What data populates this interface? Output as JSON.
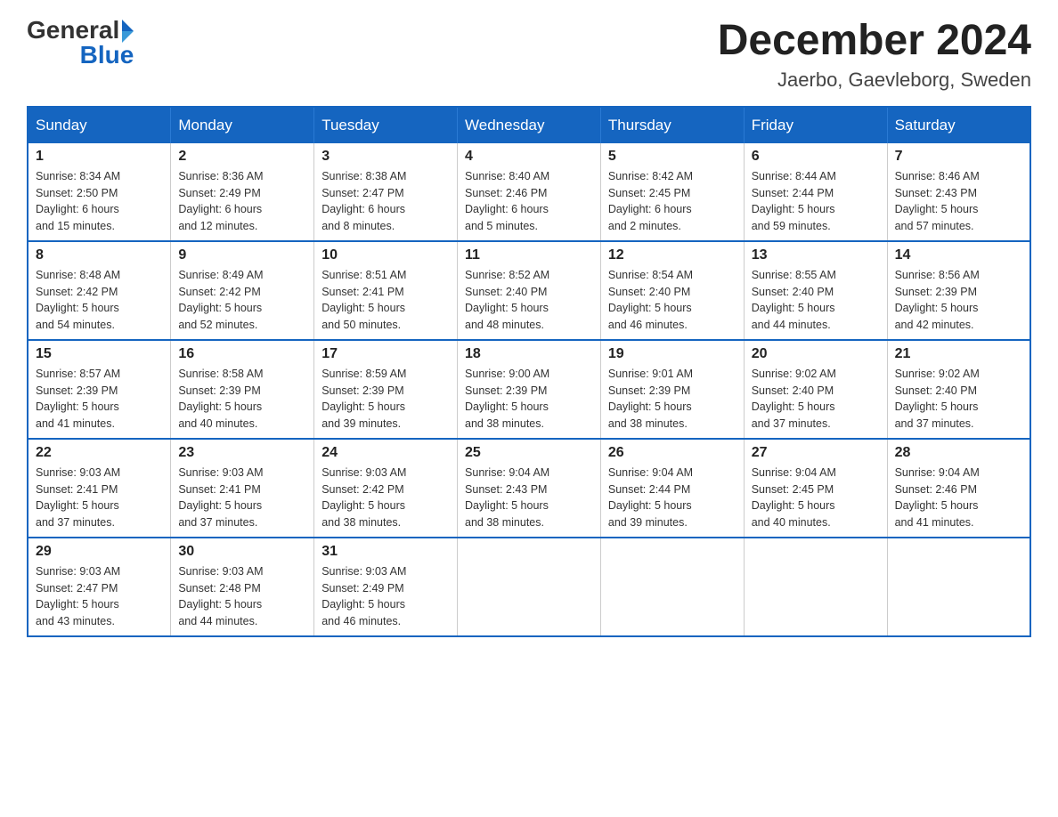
{
  "header": {
    "logo": {
      "text_general": "General",
      "text_blue": "Blue"
    },
    "month_title": "December 2024",
    "location": "Jaerbo, Gaevleborg, Sweden"
  },
  "weekdays": [
    "Sunday",
    "Monday",
    "Tuesday",
    "Wednesday",
    "Thursday",
    "Friday",
    "Saturday"
  ],
  "weeks": [
    [
      {
        "day": "1",
        "sunrise": "Sunrise: 8:34 AM",
        "sunset": "Sunset: 2:50 PM",
        "daylight": "Daylight: 6 hours",
        "daylight2": "and 15 minutes."
      },
      {
        "day": "2",
        "sunrise": "Sunrise: 8:36 AM",
        "sunset": "Sunset: 2:49 PM",
        "daylight": "Daylight: 6 hours",
        "daylight2": "and 12 minutes."
      },
      {
        "day": "3",
        "sunrise": "Sunrise: 8:38 AM",
        "sunset": "Sunset: 2:47 PM",
        "daylight": "Daylight: 6 hours",
        "daylight2": "and 8 minutes."
      },
      {
        "day": "4",
        "sunrise": "Sunrise: 8:40 AM",
        "sunset": "Sunset: 2:46 PM",
        "daylight": "Daylight: 6 hours",
        "daylight2": "and 5 minutes."
      },
      {
        "day": "5",
        "sunrise": "Sunrise: 8:42 AM",
        "sunset": "Sunset: 2:45 PM",
        "daylight": "Daylight: 6 hours",
        "daylight2": "and 2 minutes."
      },
      {
        "day": "6",
        "sunrise": "Sunrise: 8:44 AM",
        "sunset": "Sunset: 2:44 PM",
        "daylight": "Daylight: 5 hours",
        "daylight2": "and 59 minutes."
      },
      {
        "day": "7",
        "sunrise": "Sunrise: 8:46 AM",
        "sunset": "Sunset: 2:43 PM",
        "daylight": "Daylight: 5 hours",
        "daylight2": "and 57 minutes."
      }
    ],
    [
      {
        "day": "8",
        "sunrise": "Sunrise: 8:48 AM",
        "sunset": "Sunset: 2:42 PM",
        "daylight": "Daylight: 5 hours",
        "daylight2": "and 54 minutes."
      },
      {
        "day": "9",
        "sunrise": "Sunrise: 8:49 AM",
        "sunset": "Sunset: 2:42 PM",
        "daylight": "Daylight: 5 hours",
        "daylight2": "and 52 minutes."
      },
      {
        "day": "10",
        "sunrise": "Sunrise: 8:51 AM",
        "sunset": "Sunset: 2:41 PM",
        "daylight": "Daylight: 5 hours",
        "daylight2": "and 50 minutes."
      },
      {
        "day": "11",
        "sunrise": "Sunrise: 8:52 AM",
        "sunset": "Sunset: 2:40 PM",
        "daylight": "Daylight: 5 hours",
        "daylight2": "and 48 minutes."
      },
      {
        "day": "12",
        "sunrise": "Sunrise: 8:54 AM",
        "sunset": "Sunset: 2:40 PM",
        "daylight": "Daylight: 5 hours",
        "daylight2": "and 46 minutes."
      },
      {
        "day": "13",
        "sunrise": "Sunrise: 8:55 AM",
        "sunset": "Sunset: 2:40 PM",
        "daylight": "Daylight: 5 hours",
        "daylight2": "and 44 minutes."
      },
      {
        "day": "14",
        "sunrise": "Sunrise: 8:56 AM",
        "sunset": "Sunset: 2:39 PM",
        "daylight": "Daylight: 5 hours",
        "daylight2": "and 42 minutes."
      }
    ],
    [
      {
        "day": "15",
        "sunrise": "Sunrise: 8:57 AM",
        "sunset": "Sunset: 2:39 PM",
        "daylight": "Daylight: 5 hours",
        "daylight2": "and 41 minutes."
      },
      {
        "day": "16",
        "sunrise": "Sunrise: 8:58 AM",
        "sunset": "Sunset: 2:39 PM",
        "daylight": "Daylight: 5 hours",
        "daylight2": "and 40 minutes."
      },
      {
        "day": "17",
        "sunrise": "Sunrise: 8:59 AM",
        "sunset": "Sunset: 2:39 PM",
        "daylight": "Daylight: 5 hours",
        "daylight2": "and 39 minutes."
      },
      {
        "day": "18",
        "sunrise": "Sunrise: 9:00 AM",
        "sunset": "Sunset: 2:39 PM",
        "daylight": "Daylight: 5 hours",
        "daylight2": "and 38 minutes."
      },
      {
        "day": "19",
        "sunrise": "Sunrise: 9:01 AM",
        "sunset": "Sunset: 2:39 PM",
        "daylight": "Daylight: 5 hours",
        "daylight2": "and 38 minutes."
      },
      {
        "day": "20",
        "sunrise": "Sunrise: 9:02 AM",
        "sunset": "Sunset: 2:40 PM",
        "daylight": "Daylight: 5 hours",
        "daylight2": "and 37 minutes."
      },
      {
        "day": "21",
        "sunrise": "Sunrise: 9:02 AM",
        "sunset": "Sunset: 2:40 PM",
        "daylight": "Daylight: 5 hours",
        "daylight2": "and 37 minutes."
      }
    ],
    [
      {
        "day": "22",
        "sunrise": "Sunrise: 9:03 AM",
        "sunset": "Sunset: 2:41 PM",
        "daylight": "Daylight: 5 hours",
        "daylight2": "and 37 minutes."
      },
      {
        "day": "23",
        "sunrise": "Sunrise: 9:03 AM",
        "sunset": "Sunset: 2:41 PM",
        "daylight": "Daylight: 5 hours",
        "daylight2": "and 37 minutes."
      },
      {
        "day": "24",
        "sunrise": "Sunrise: 9:03 AM",
        "sunset": "Sunset: 2:42 PM",
        "daylight": "Daylight: 5 hours",
        "daylight2": "and 38 minutes."
      },
      {
        "day": "25",
        "sunrise": "Sunrise: 9:04 AM",
        "sunset": "Sunset: 2:43 PM",
        "daylight": "Daylight: 5 hours",
        "daylight2": "and 38 minutes."
      },
      {
        "day": "26",
        "sunrise": "Sunrise: 9:04 AM",
        "sunset": "Sunset: 2:44 PM",
        "daylight": "Daylight: 5 hours",
        "daylight2": "and 39 minutes."
      },
      {
        "day": "27",
        "sunrise": "Sunrise: 9:04 AM",
        "sunset": "Sunset: 2:45 PM",
        "daylight": "Daylight: 5 hours",
        "daylight2": "and 40 minutes."
      },
      {
        "day": "28",
        "sunrise": "Sunrise: 9:04 AM",
        "sunset": "Sunset: 2:46 PM",
        "daylight": "Daylight: 5 hours",
        "daylight2": "and 41 minutes."
      }
    ],
    [
      {
        "day": "29",
        "sunrise": "Sunrise: 9:03 AM",
        "sunset": "Sunset: 2:47 PM",
        "daylight": "Daylight: 5 hours",
        "daylight2": "and 43 minutes."
      },
      {
        "day": "30",
        "sunrise": "Sunrise: 9:03 AM",
        "sunset": "Sunset: 2:48 PM",
        "daylight": "Daylight: 5 hours",
        "daylight2": "and 44 minutes."
      },
      {
        "day": "31",
        "sunrise": "Sunrise: 9:03 AM",
        "sunset": "Sunset: 2:49 PM",
        "daylight": "Daylight: 5 hours",
        "daylight2": "and 46 minutes."
      },
      null,
      null,
      null,
      null
    ]
  ]
}
